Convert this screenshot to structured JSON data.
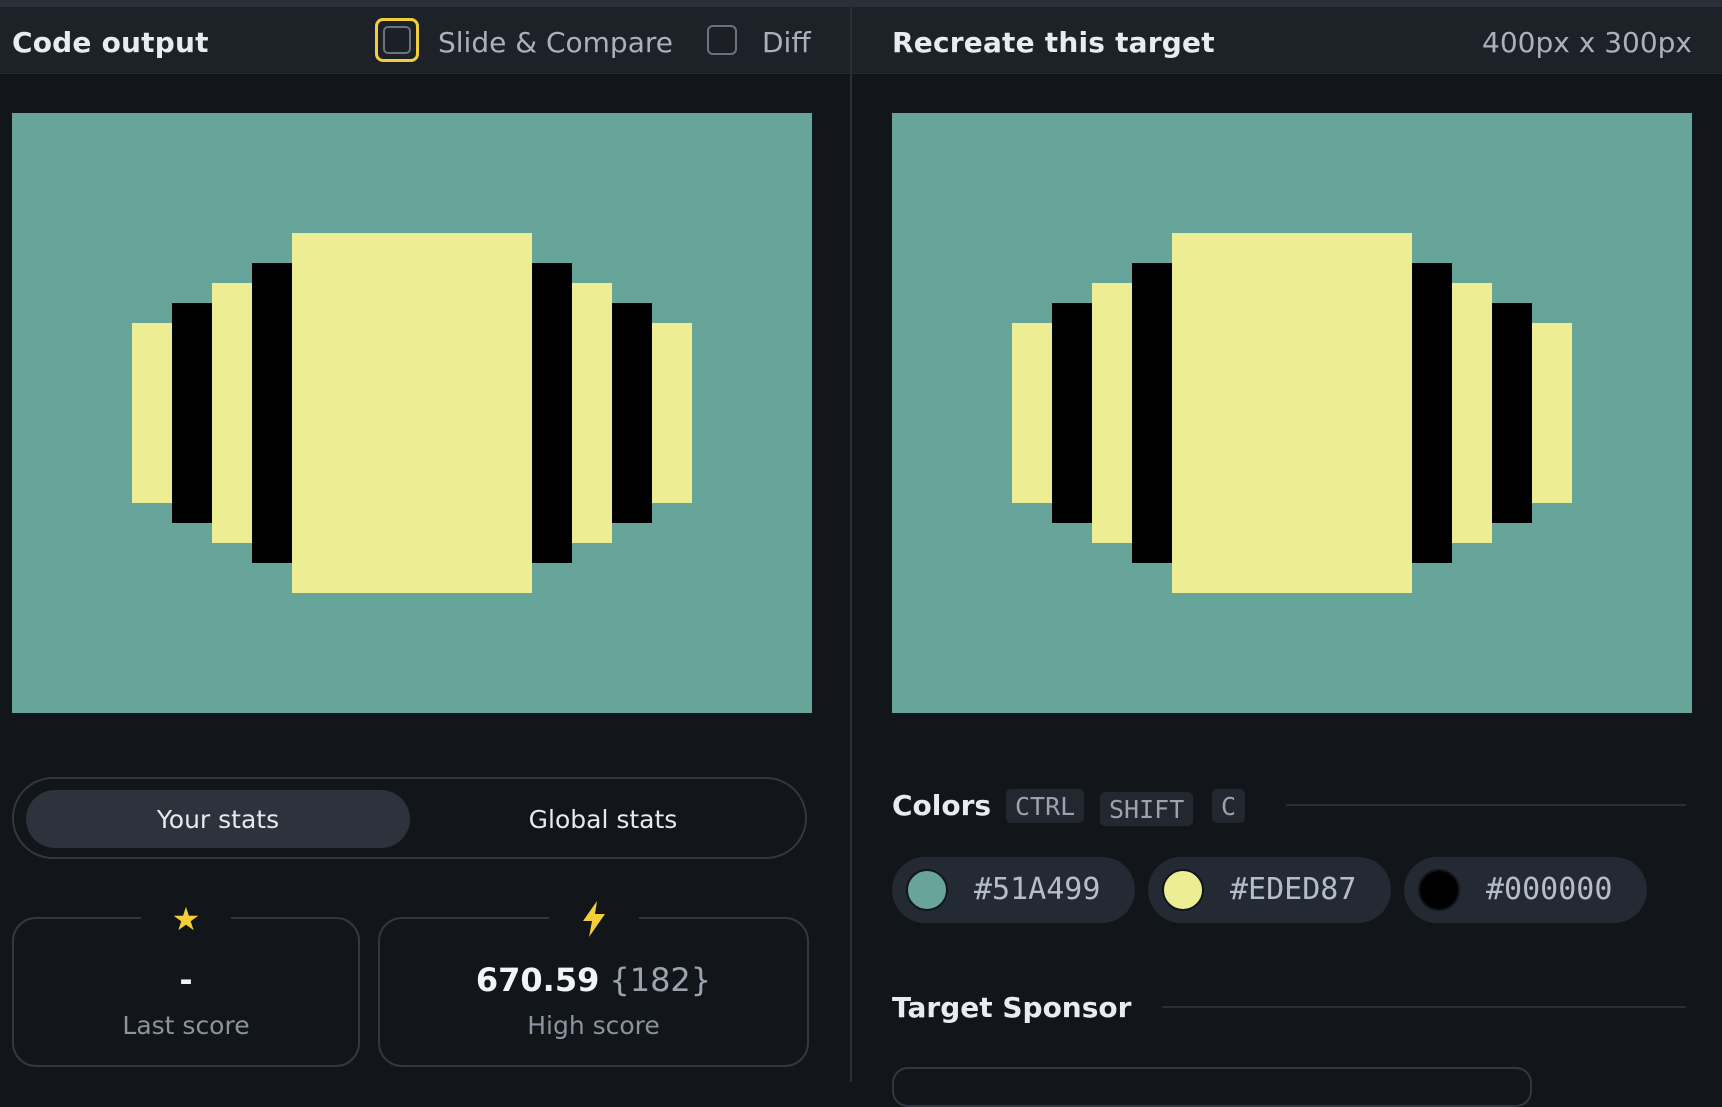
{
  "left_panel": {
    "title": "Code output",
    "slide_compare_label": "Slide & Compare",
    "slide_compare_checked": false,
    "diff_label": "Diff",
    "diff_checked": false
  },
  "right_panel": {
    "title": "Recreate this target",
    "dimensions": "400px x 300px"
  },
  "stats": {
    "tabs": [
      "Your stats",
      "Global stats"
    ],
    "active_tab": "Your stats",
    "last_score": {
      "icon": "star-icon",
      "value": "-",
      "label": "Last score"
    },
    "high_score": {
      "icon": "lightning-icon",
      "value": "670.59",
      "sub": "{182}",
      "label": "High score"
    }
  },
  "colors_section": {
    "title": "Colors",
    "shortcut": [
      "CTRL",
      "SHIFT",
      "C"
    ],
    "swatches": [
      {
        "hex": "#51A499",
        "color": "#51A499"
      },
      {
        "hex": "#EDED87",
        "color": "#EDED87"
      },
      {
        "hex": "#000000",
        "color": "#000000"
      }
    ]
  },
  "sponsor_section": {
    "title": "Target Sponsor"
  },
  "theme": {
    "accent": "#f2cf3a",
    "canvas_bg": "#67a499",
    "shape_yellow": "#eded94",
    "shape_black": "#000000"
  }
}
